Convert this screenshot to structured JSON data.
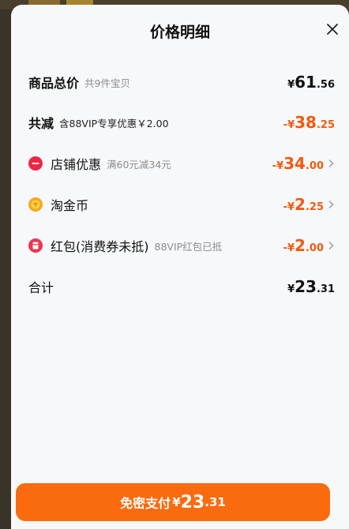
{
  "header": {
    "title": "价格明细"
  },
  "rows": {
    "total_goods": {
      "label": "商品总价",
      "sub": "共9件宝贝",
      "currency": "¥",
      "int": "61",
      "dec": ".56"
    },
    "total_reduce": {
      "label": "共减",
      "sub": "含88VIP专享优惠￥2.00",
      "currency": "-¥",
      "int": "38",
      "dec": ".25"
    },
    "shop_discount": {
      "label": "店铺优惠",
      "sub": "满60元减34元",
      "currency": "-¥",
      "int": "34",
      "dec": ".00",
      "icon": "shop-discount-icon"
    },
    "taojinbi": {
      "label": "淘金币",
      "currency": "-¥",
      "int": "2",
      "dec": ".25",
      "icon": "coin-icon"
    },
    "red_packet": {
      "label": "红包(消费券未抵)",
      "sub": "88VIP红包已抵",
      "currency": "-¥",
      "int": "2",
      "dec": ".00",
      "icon": "red-packet-icon"
    },
    "sum": {
      "label": "合计",
      "currency": "¥",
      "int": "23",
      "dec": ".31"
    }
  },
  "pay_button": {
    "label": "免密支付",
    "currency": "¥",
    "int": "23",
    "dec": ".31"
  },
  "colors": {
    "accent": "#fa6b0f",
    "discount_text": "#f25a0f",
    "background": "#f7f8fa"
  }
}
